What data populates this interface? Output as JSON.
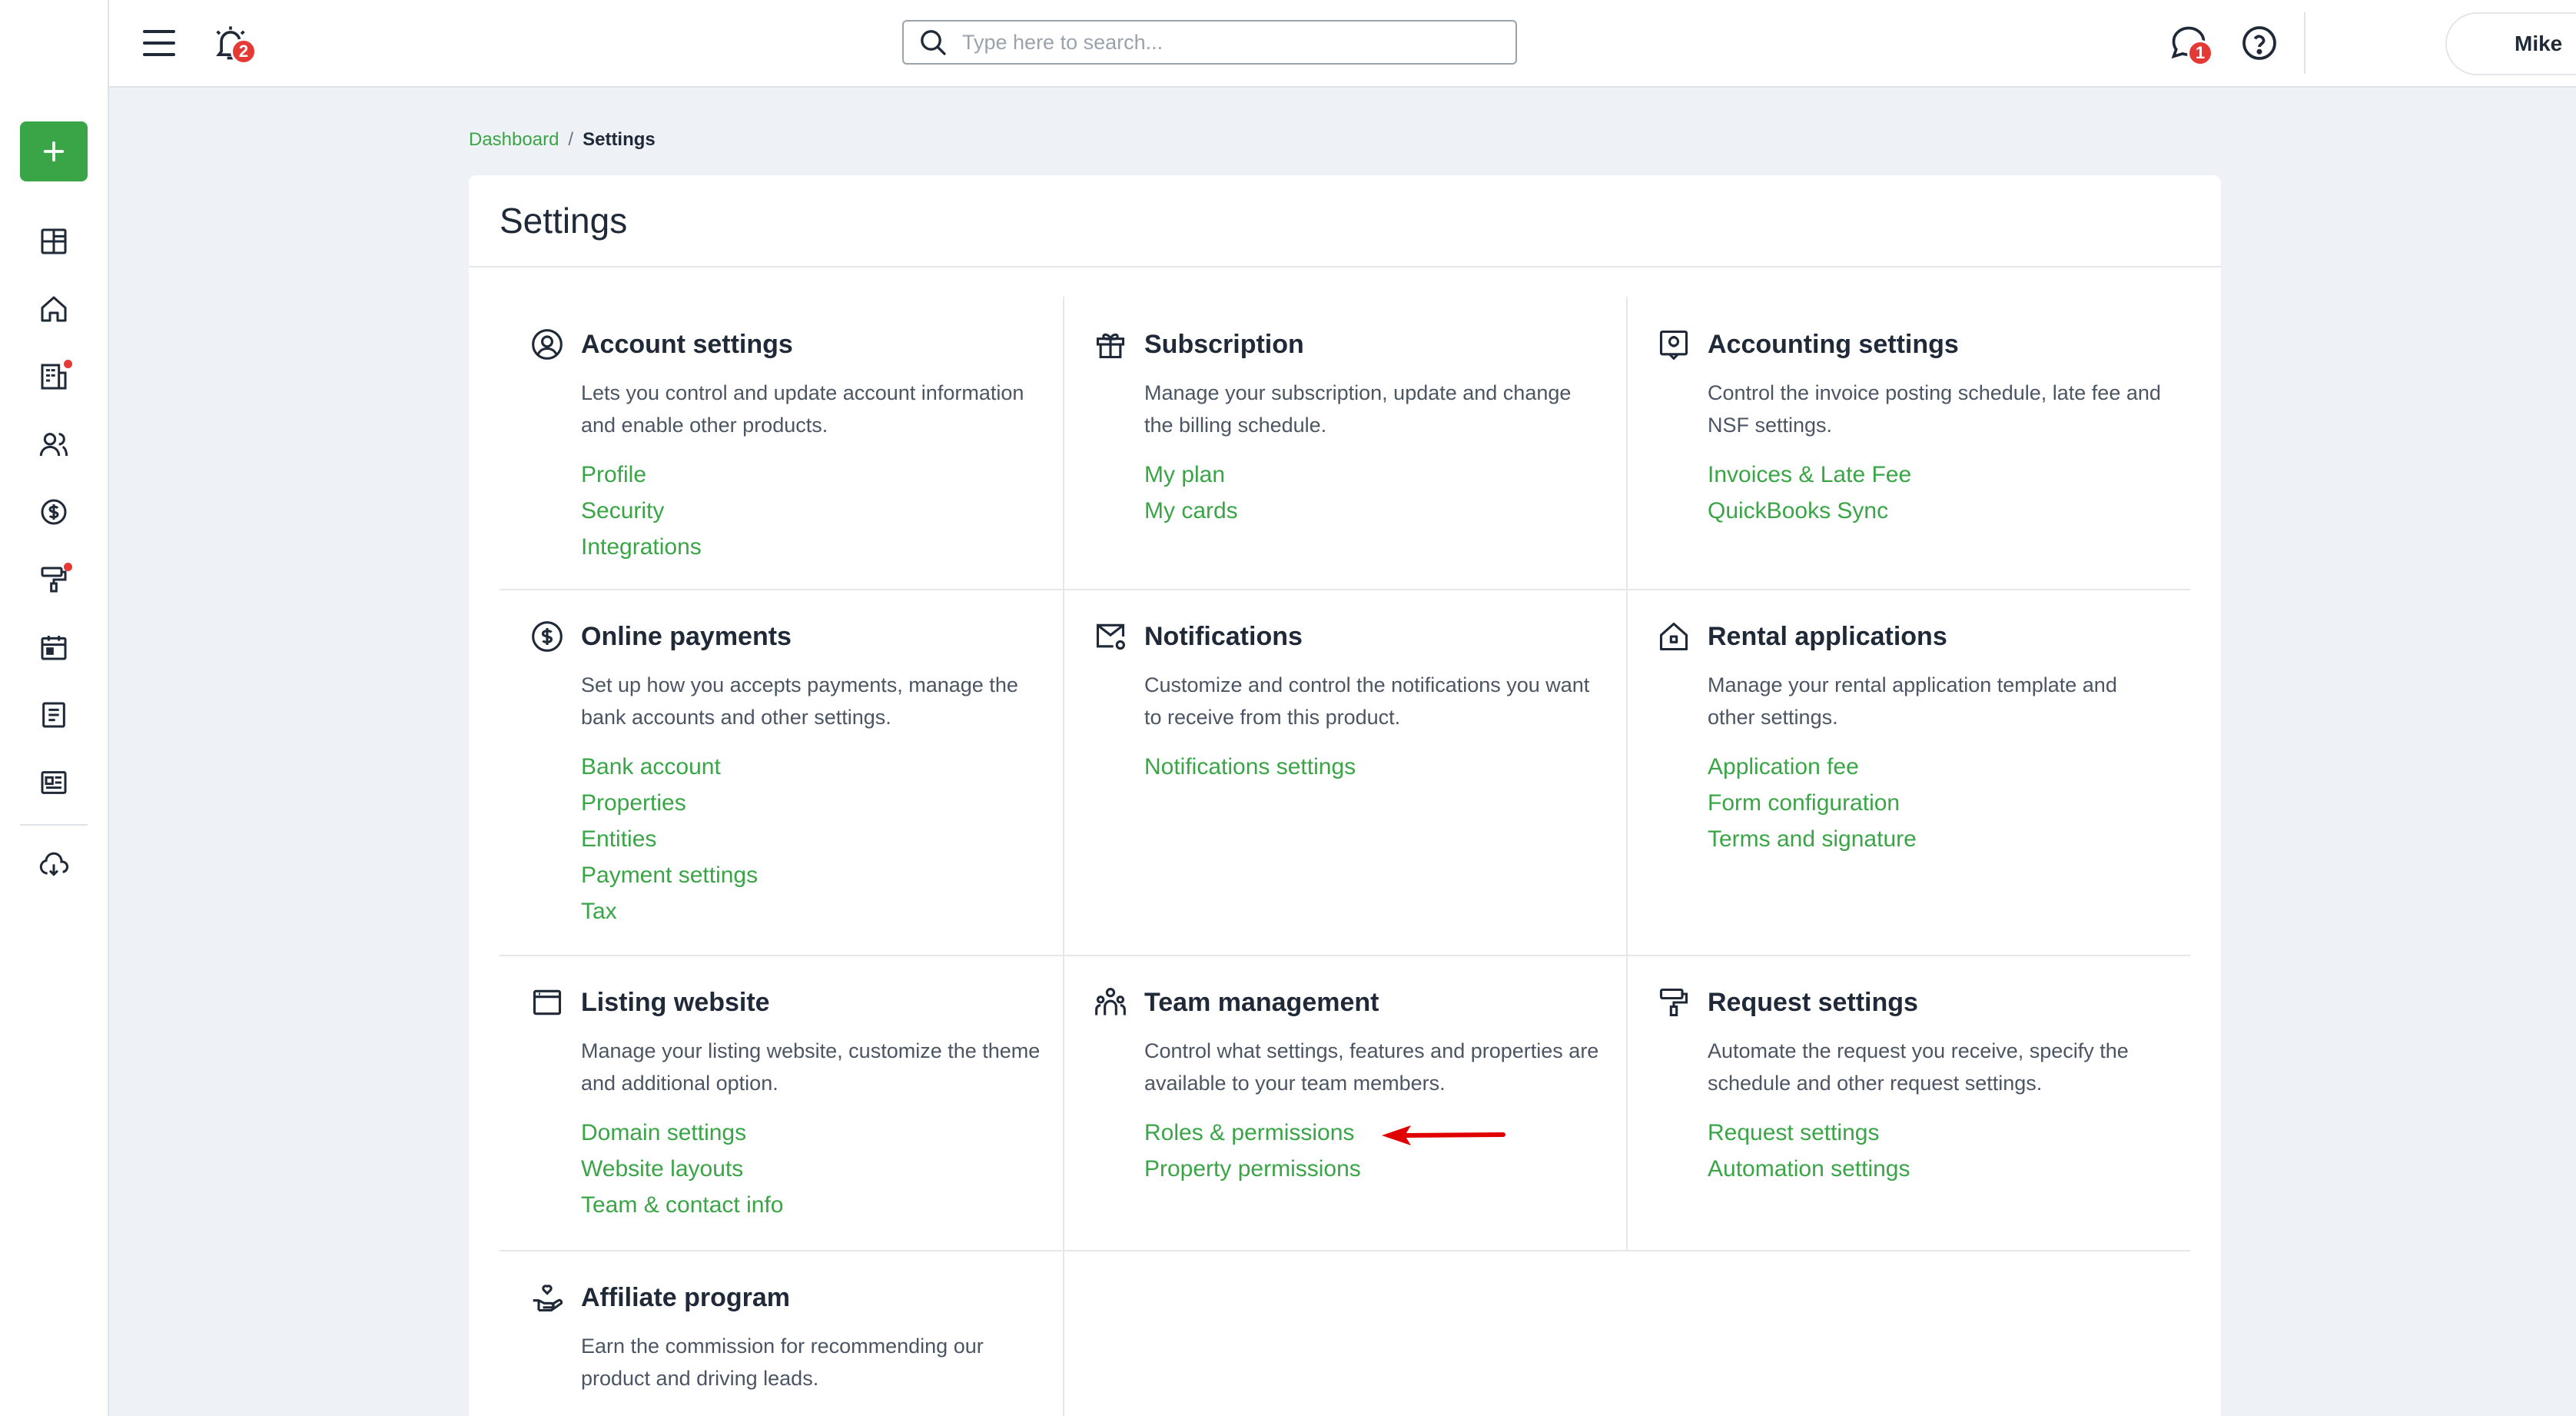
{
  "topbar": {
    "alarm_badge": "2",
    "search_placeholder": "Type here to search...",
    "chat_badge": "1",
    "user_name": "Mike"
  },
  "breadcrumb": {
    "parent": "Dashboard",
    "separator": "/",
    "current": "Settings"
  },
  "page": {
    "title": "Settings"
  },
  "sections": [
    {
      "title": "Account settings",
      "icon": "user-circle-icon",
      "description": "Lets you control and update account information and enable other products.",
      "links": [
        "Profile",
        "Security",
        "Integrations"
      ]
    },
    {
      "title": "Subscription",
      "icon": "gift-icon",
      "description": "Manage your subscription, update and change the billing schedule.",
      "links": [
        "My plan",
        "My cards"
      ]
    },
    {
      "title": "Accounting settings",
      "icon": "accounting-icon",
      "description": "Control the invoice posting schedule, late fee and NSF settings.",
      "links": [
        "Invoices & Late Fee",
        "QuickBooks Sync"
      ]
    },
    {
      "title": "Online payments",
      "icon": "dollar-circle-icon",
      "description": "Set up how you accepts payments, manage the bank accounts and other settings.",
      "links": [
        "Bank account",
        "Properties",
        "Entities",
        "Payment settings",
        "Tax"
      ]
    },
    {
      "title": "Notifications",
      "icon": "mail-settings-icon",
      "description": "Customize and control the notifications you want to receive from this product.",
      "links": [
        "Notifications settings"
      ]
    },
    {
      "title": "Rental applications",
      "icon": "house-icon",
      "description": "Manage your rental application template and other settings.",
      "links": [
        "Application fee",
        "Form configuration",
        "Terms and signature"
      ]
    },
    {
      "title": "Listing website",
      "icon": "browser-window-icon",
      "description": "Manage your listing website, customize the theme and additional option.",
      "links": [
        "Domain settings",
        "Website layouts",
        "Team & contact info"
      ]
    },
    {
      "title": "Team management",
      "icon": "team-icon",
      "description": "Control what settings, features and properties are available to your team members.",
      "links": [
        "Roles & permissions",
        "Property permissions"
      ]
    },
    {
      "title": "Request settings",
      "icon": "paint-roller-icon",
      "description": "Automate the request you receive, specify the schedule and other request settings.",
      "links": [
        "Request settings",
        "Automation settings"
      ]
    },
    {
      "title": "Affiliate program",
      "icon": "hand-heart-icon",
      "description": "Earn the commission for recommending our product and driving leads.",
      "links": []
    }
  ],
  "colors": {
    "accent": "#3aa546",
    "badge": "#e53935",
    "annotation_arrow": "#e00000"
  }
}
